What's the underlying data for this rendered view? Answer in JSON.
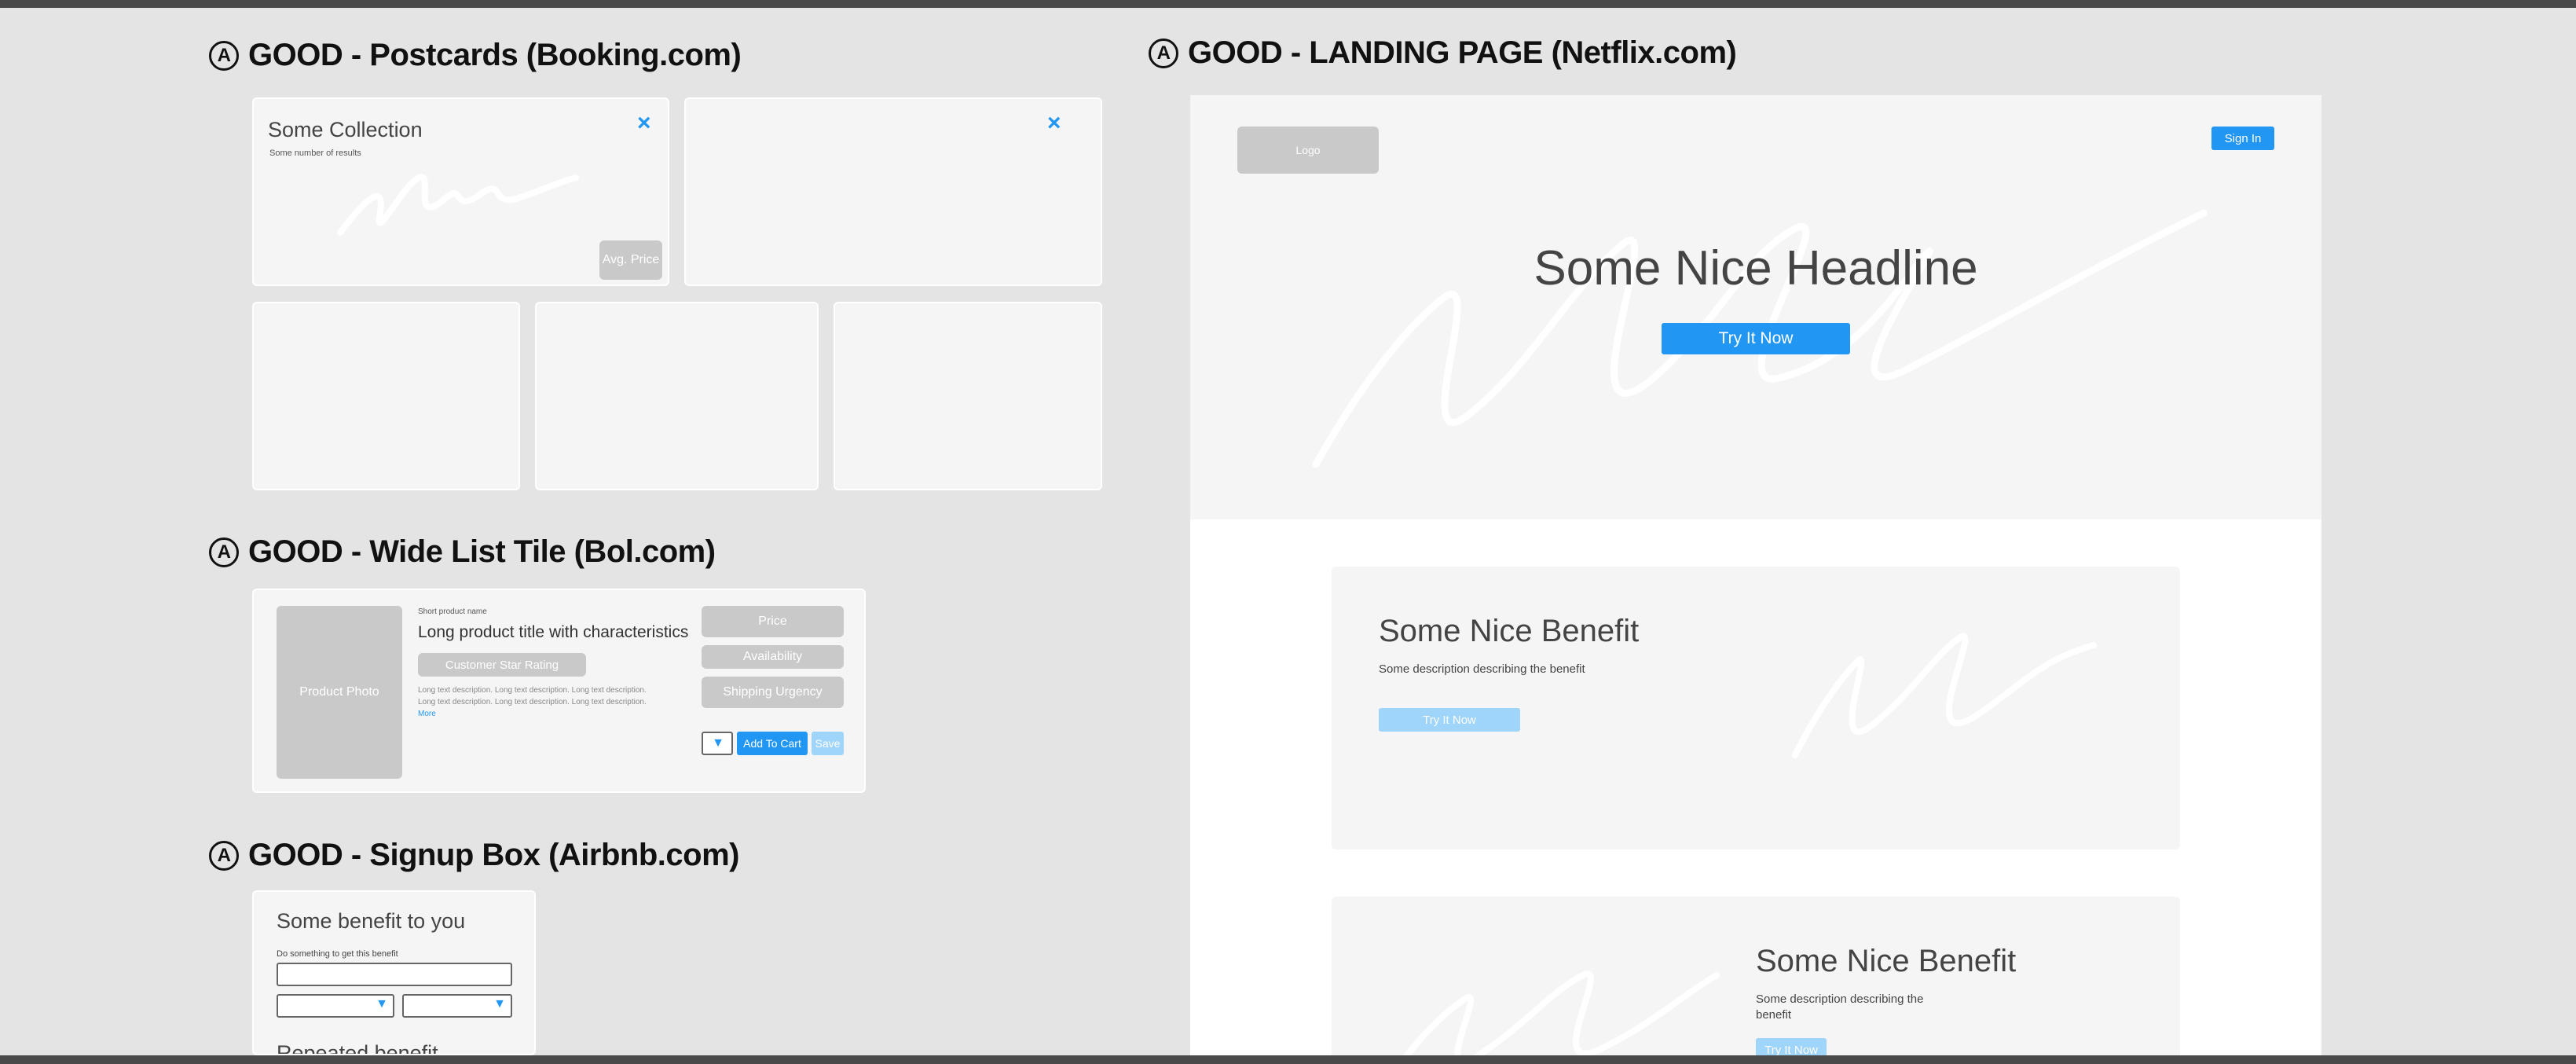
{
  "sections": {
    "postcards": {
      "badge": "A",
      "title": "GOOD - Postcards (Booking.com)"
    },
    "wide_list": {
      "badge": "A",
      "title": "GOOD - Wide List Tile (Bol.com)"
    },
    "signup": {
      "badge": "A",
      "title": "GOOD - Signup Box (Airbnb.com)"
    },
    "landing": {
      "badge": "A",
      "title": "GOOD - LANDING PAGE (Netflix.com)"
    }
  },
  "postcards": {
    "main_card": {
      "title": "Some Collection",
      "subtitle": "Some number of results",
      "price_label": "Avg. Price",
      "close_icon": "×"
    },
    "second_card": {
      "close_icon": "×"
    }
  },
  "wide_list": {
    "photo_label": "Product Photo",
    "short_name": "Short product name",
    "long_title": "Long product title with characteristics",
    "rating_label": "Customer Star Rating",
    "description_line1": "Long text description. Long text description. Long text description.",
    "description_line2": "Long text description. Long text description. Long text description.",
    "more_link": "More",
    "price_label": "Price",
    "availability_label": "Availability",
    "shipping_label": "Shipping Urgency",
    "quantity_caret": "▼",
    "add_to_cart_label": "Add To Cart",
    "save_label": "Save"
  },
  "signup": {
    "title": "Some benefit to you",
    "field_label": "Do something to get this benefit",
    "caret": "▼",
    "repeated_title": "Repeated benefit"
  },
  "landing": {
    "logo_label": "Logo",
    "sign_in_label": "Sign In",
    "headline": "Some Nice Headline",
    "cta_label": "Try It Now",
    "benefits": [
      {
        "title": "Some Nice Benefit",
        "description": "Some description describing the benefit",
        "cta_label": "Try It Now"
      },
      {
        "title": "Some Nice Benefit",
        "description": "Some description describing the",
        "description_line2": "benefit",
        "cta_label": "Try It Now"
      }
    ]
  },
  "colors": {
    "accent": "#2196f3",
    "accent_light": "#9fd4fb",
    "placeholder_grey": "#c9c9c9",
    "card_bg": "#f5f5f5",
    "page_bg": "#e4e4e4"
  }
}
